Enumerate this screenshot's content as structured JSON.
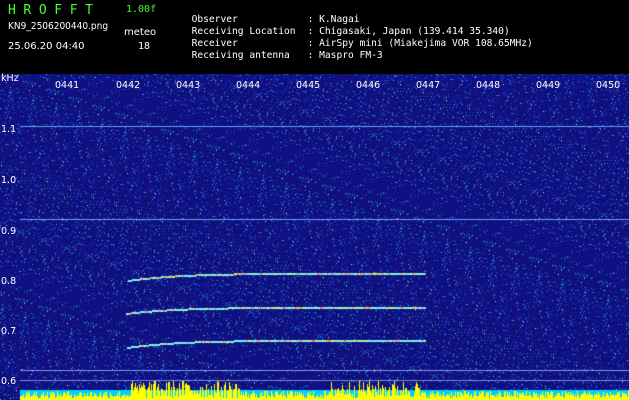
{
  "header": {
    "title": "HROFFT",
    "version": "1.00f",
    "file_name": "KN9_2506200440.png",
    "mode_label": "meteo",
    "timestamp": "25.06.20 04:40",
    "mode_value": "18"
  },
  "info": [
    {
      "key": "Observer",
      "value": ": K.Nagai"
    },
    {
      "key": "Receiving Location",
      "value": ": Chigasaki, Japan (139.414 35.340)"
    },
    {
      "key": "Receiver",
      "value": ": AirSpy mini (Miakejima VOR 108.65MHz)"
    },
    {
      "key": "Receiving antenna",
      "value": ": Maspro FM-3"
    }
  ],
  "axes": {
    "y_unit": "kHz",
    "y_ticks": [
      "1.1",
      "1.0",
      "0.9",
      "0.8",
      "0.7",
      "0.6"
    ],
    "x_ticks": [
      "0441",
      "0442",
      "0443",
      "0444",
      "0445",
      "0446",
      "0447",
      "0448",
      "0449",
      "0450"
    ]
  },
  "colors": {
    "background": "#10107a",
    "title_green": "#48ff2e",
    "noise_bar": "#ffff00",
    "baseline": "#00d0ff"
  }
}
